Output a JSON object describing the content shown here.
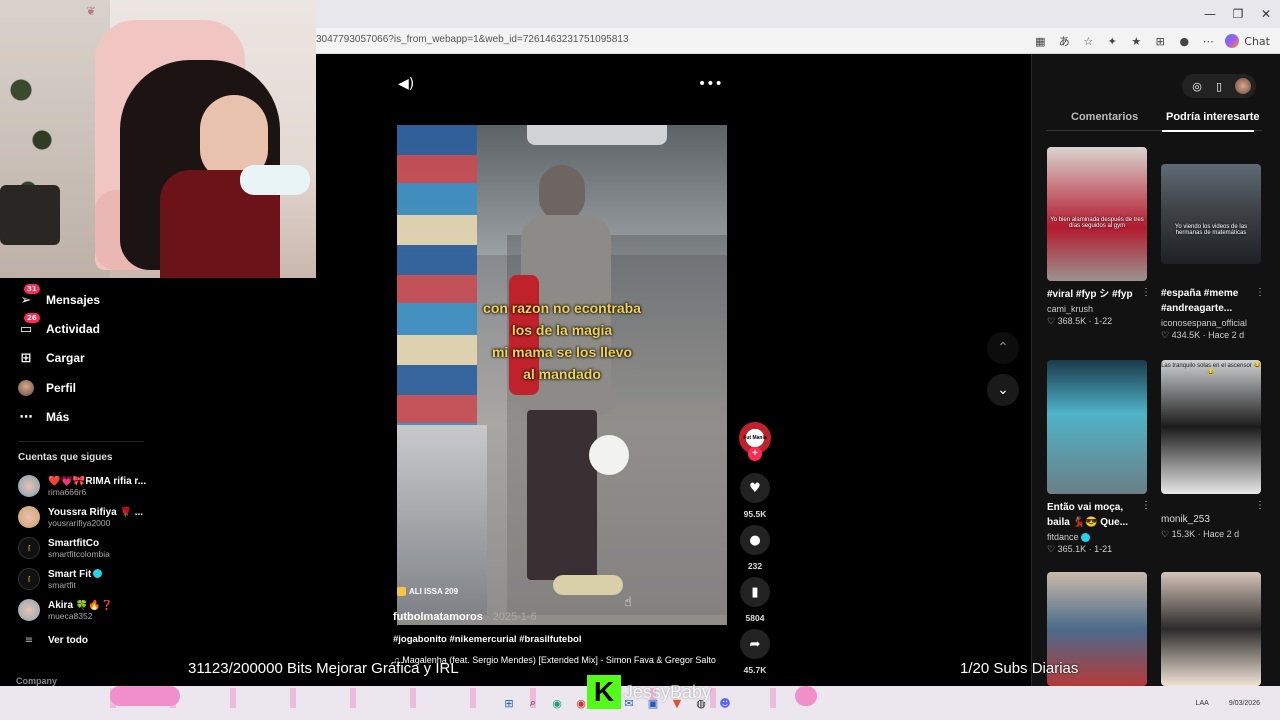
{
  "browser": {
    "url": "3047793057066?is_from_webapp=1&web_id=7261463231751095813",
    "chat_label": "Chat",
    "icons": [
      "reader-icon",
      "translate-icon",
      "star-icon",
      "extensions-icon",
      "favorites-icon",
      "profile-icon",
      "more-icon",
      "copilot-icon"
    ]
  },
  "sidebar": {
    "items": [
      {
        "label": "Mensajes",
        "badge": "31",
        "icon": "paper-plane-icon"
      },
      {
        "label": "Actividad",
        "badge": "26",
        "icon": "inbox-icon"
      },
      {
        "label": "Cargar",
        "badge": "",
        "icon": "upload-icon"
      },
      {
        "label": "Perfil",
        "badge": "",
        "icon": "profile-icon"
      },
      {
        "label": "Más",
        "badge": "",
        "icon": "more-icon"
      }
    ],
    "following_title": "Cuentas que sigues",
    "following": [
      {
        "name": "❤️💗🎀RIMA rifia r...",
        "handle": "rima666r6",
        "verified": false,
        "color": "#7a9fb8"
      },
      {
        "name": "Youssra Rifiya 🌹 ...",
        "handle": "yousrarifiya2000",
        "verified": false,
        "color": "#c9a06a"
      },
      {
        "name": "SmartfitCo",
        "handle": "smartfitcolombia",
        "verified": false,
        "color": "#111111"
      },
      {
        "name": "Smart Fit",
        "handle": "smartfit",
        "verified": true,
        "color": "#111111"
      },
      {
        "name": "Akira 🍀🔥❓",
        "handle": "mueca8352",
        "verified": false,
        "color": "#8aa7b9"
      }
    ],
    "see_all": "Ver todo",
    "company": "Company"
  },
  "video": {
    "caption_lines": [
      "con razon no econtraba",
      "los de la magia",
      "mi mama se los llevo",
      "al mandado"
    ],
    "watermark": "ALI ISSA 209",
    "author": "futbolmatamoros",
    "date": "· 2025-1-6",
    "hashtags": "#jogabonito #nikemercurial #brasilfutebol",
    "music": "♫  Magalenha (feat. Sergio Mendes) [Extended Mix] - Simon Fava & Gregor Salto"
  },
  "actions": {
    "creator_label": "Fut Mania",
    "likes": "95.5K",
    "comments": "232",
    "saves": "5804",
    "shares": "45.7K"
  },
  "right_panel": {
    "tabs": [
      "Comentarios",
      "Podría interesarte"
    ],
    "active_tab": 1,
    "cards": [
      {
        "title": "#viral #fyp シ #fyp",
        "user": "cami_krush",
        "meta": "♡ 368.5K · 1-22",
        "thumb_text": "Yo bien alaminada después de tres días seguidos al gym",
        "bg": "linear-gradient(180deg,#d9d4cf,#b31a2f 70%,#9a9490)"
      },
      {
        "title": "#españa #meme #andreagarte...",
        "user": "iconosespana_official",
        "meta": "♡ 434.5K · Hace 2 d",
        "thumb_text": "Yo viendo los videos de las hermanas de matemáticas",
        "bg": "linear-gradient(180deg,#5f6a74,#3c3f44 50%,#1d2025)"
      },
      {
        "title": "Então vai moça, baila 💃🏽😎 Que...",
        "user": "fitdance",
        "meta": "♡ 365.1K · 1-21",
        "thumb_text": "",
        "bg": "linear-gradient(180deg,#1a3a4a,#4fb3c8 40%,#6c7f86)"
      },
      {
        "title": "monik_253",
        "user": "",
        "meta": "♡ 15.3K · Hace 2 d",
        "thumb_text": "Las tranquilo solas en el ascensor 😂😂",
        "bg": "linear-gradient(180deg,#cfd1d3,#1b1b1b 50%,#e8e8e8)"
      },
      {
        "title": "",
        "user": "",
        "meta": "",
        "thumb_text": "",
        "bg": "linear-gradient(180deg,#c9b9a9,#4a6b8a 50%,#b33a3a)"
      },
      {
        "title": "",
        "user": "",
        "meta": "",
        "thumb_text": "",
        "bg": "linear-gradient(180deg,#d4c3b8,#2b2b2b 50%,#f1e3d6)"
      }
    ]
  },
  "overlay": {
    "bits": "31123/200000 Bits Mejorar Gráfica y IRL",
    "subs": "1/20 Subs Diarias",
    "kick_letter": "K",
    "streamer": "JessyBaby"
  },
  "taskbar": {
    "lang": "LAA",
    "date": "9/03/2026"
  }
}
